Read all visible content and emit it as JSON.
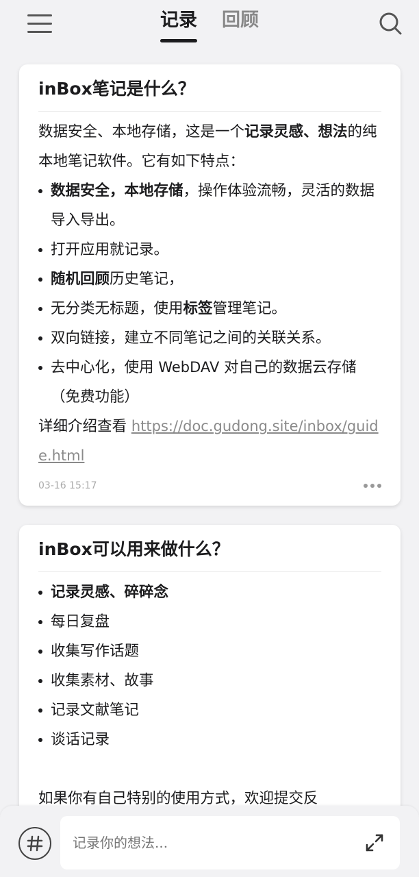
{
  "header": {
    "tabs": [
      {
        "label": "记录",
        "active": true
      },
      {
        "label": "回顾",
        "active": false
      }
    ],
    "icons": {
      "menu": "menu-icon",
      "search": "search-icon"
    }
  },
  "notes": [
    {
      "title": "inBox笔记是什么？",
      "intro": {
        "p1": "数据安全、本地存储，这是一个",
        "b1": "记录灵感、想法",
        "p2": "的纯本地笔记软件。它有如下特点："
      },
      "bullets": [
        {
          "bold": "数据安全，本地存储",
          "text": "，操作体验流畅，灵活的数据导入导出。"
        },
        {
          "bold": "",
          "text": "打开应用就记录。"
        },
        {
          "bold": "随机回顾",
          "text": "历史笔记，"
        },
        {
          "pre": "无分类无标题，使用",
          "bold": "标签",
          "text": "管理笔记。"
        },
        {
          "bold": "",
          "text": "双向链接，建立不同笔记之间的关联关系。"
        },
        {
          "pre": "去中心化，使用 ",
          "latin": "WebDAV",
          "text": " 对自己的数据云存储（免费功能）"
        }
      ],
      "footer_prefix": "详细介绍查看 ",
      "link": "https://doc.gudong.site/inbox/guide.html",
      "timestamp": "03-16 15:17"
    },
    {
      "title": "inBox可以用来做什么？",
      "bullets": [
        {
          "bold": "记录灵感、碎碎念",
          "text": ""
        },
        {
          "bold": "",
          "text": "每日复盘"
        },
        {
          "bold": "",
          "text": "收集写作话题"
        },
        {
          "bold": "",
          "text": "收集素材、故事"
        },
        {
          "bold": "",
          "text": "记录文献笔记"
        },
        {
          "bold": "",
          "text": "谈话记录"
        }
      ],
      "footer": "如果你有自己特别的使用方式，欢迎提交反"
    }
  ],
  "input_bar": {
    "placeholder": "记录你的想法...",
    "icons": {
      "tag": "hashtag-icon",
      "expand": "expand-icon"
    }
  }
}
